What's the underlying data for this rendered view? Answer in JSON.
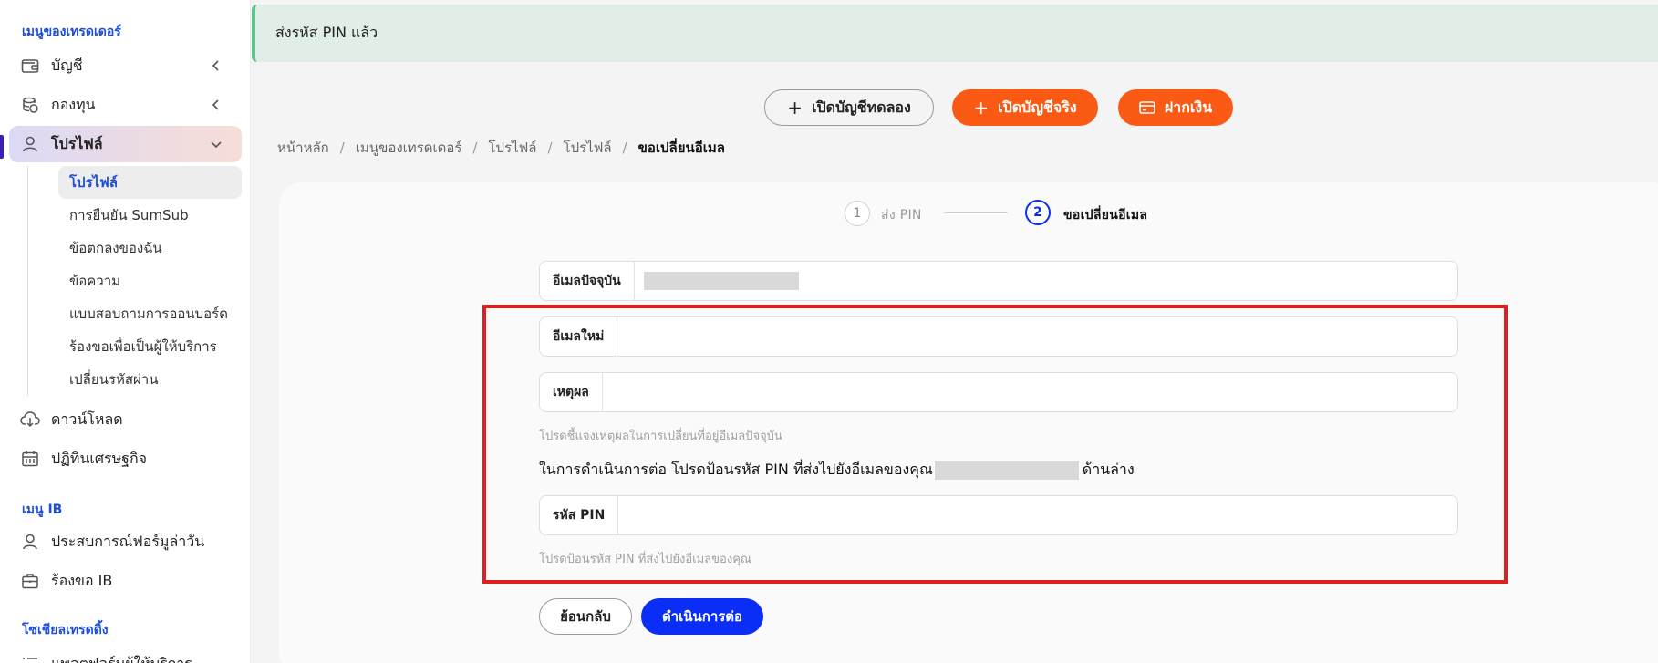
{
  "banner": {
    "message": "ส่งรหัส PIN แล้ว"
  },
  "sidebar": {
    "trader_menu_title": "เมนูของเทรดเดอร์",
    "items": [
      {
        "label": "บัญชี",
        "icon": "wallet-icon"
      },
      {
        "label": "กองทุน",
        "icon": "coins-icon"
      },
      {
        "label": "โปรไฟล์",
        "icon": "user-icon"
      }
    ],
    "profile_sub": [
      "โปรไฟล์",
      "การยืนยัน SumSub",
      "ข้อตกลงของฉัน",
      "ข้อความ",
      "แบบสอบถามการออนบอร์ด",
      "ร้องขอเพื่อเป็นผู้ให้บริการ",
      "เปลี่ยนรหัสผ่าน"
    ],
    "items2": [
      {
        "label": "ดาวน์โหลด",
        "icon": "cloud-download-icon"
      },
      {
        "label": "ปฏิทินเศรษฐกิจ",
        "icon": "calendar-icon"
      }
    ],
    "ib_title": "เมนู IB",
    "ib_items": [
      {
        "label": "ประสบการณ์ฟอร์มูล่าวัน",
        "icon": "user-icon"
      },
      {
        "label": "ร้องขอ IB",
        "icon": "briefcase-icon"
      }
    ],
    "social_title": "โซเชียลเทรดดิ้ง",
    "social_items": [
      {
        "label": "แพลตฟอร์มผู้ให้บริการ",
        "icon": "list-icon"
      }
    ]
  },
  "actions": {
    "demo_label": "เปิดบัญชีทดลอง",
    "real_label": "เปิดบัญชีจริง",
    "deposit_label": "ฝากเงิน"
  },
  "breadcrumb": [
    "หน้าหลัก",
    "เมนูของเทรดเดอร์",
    "โปรไฟล์",
    "โปรไฟล์",
    "ขอเปลี่ยนอีเมล"
  ],
  "steps": [
    {
      "number": "1",
      "label": "ส่ง PIN"
    },
    {
      "number": "2",
      "label": "ขอเปลี่ยนอีเมล"
    }
  ],
  "form": {
    "current_email_label": "อีเมลปัจจุบัน",
    "new_email_label": "อีเมลใหม่",
    "new_email_value": "",
    "reason_label": "เหตุผล",
    "reason_value": "",
    "reason_hint": "โปรดชี้แจงเหตุผลในการเปลี่ยนที่อยู่อีเมลปัจจุบัน",
    "instruction_prefix": "ในการดำเนินการต่อ โปรดป้อนรหัส PIN ที่ส่งไปยังอีเมลของคุณ",
    "instruction_suffix": "ด้านล่าง",
    "pin_label": "รหัส PIN",
    "pin_value": "",
    "pin_hint": "โปรดป้อนรหัส PIN ที่ส่งไปยังอีเมลของคุณ",
    "back_label": "ย้อนกลับ",
    "continue_label": "ดำเนินการต่อ"
  },
  "colors": {
    "accent_orange": "#fa5a14",
    "primary_blue": "#0a2ef5",
    "highlight_red": "#dd1f1f",
    "banner_green": "#5cc38a"
  }
}
